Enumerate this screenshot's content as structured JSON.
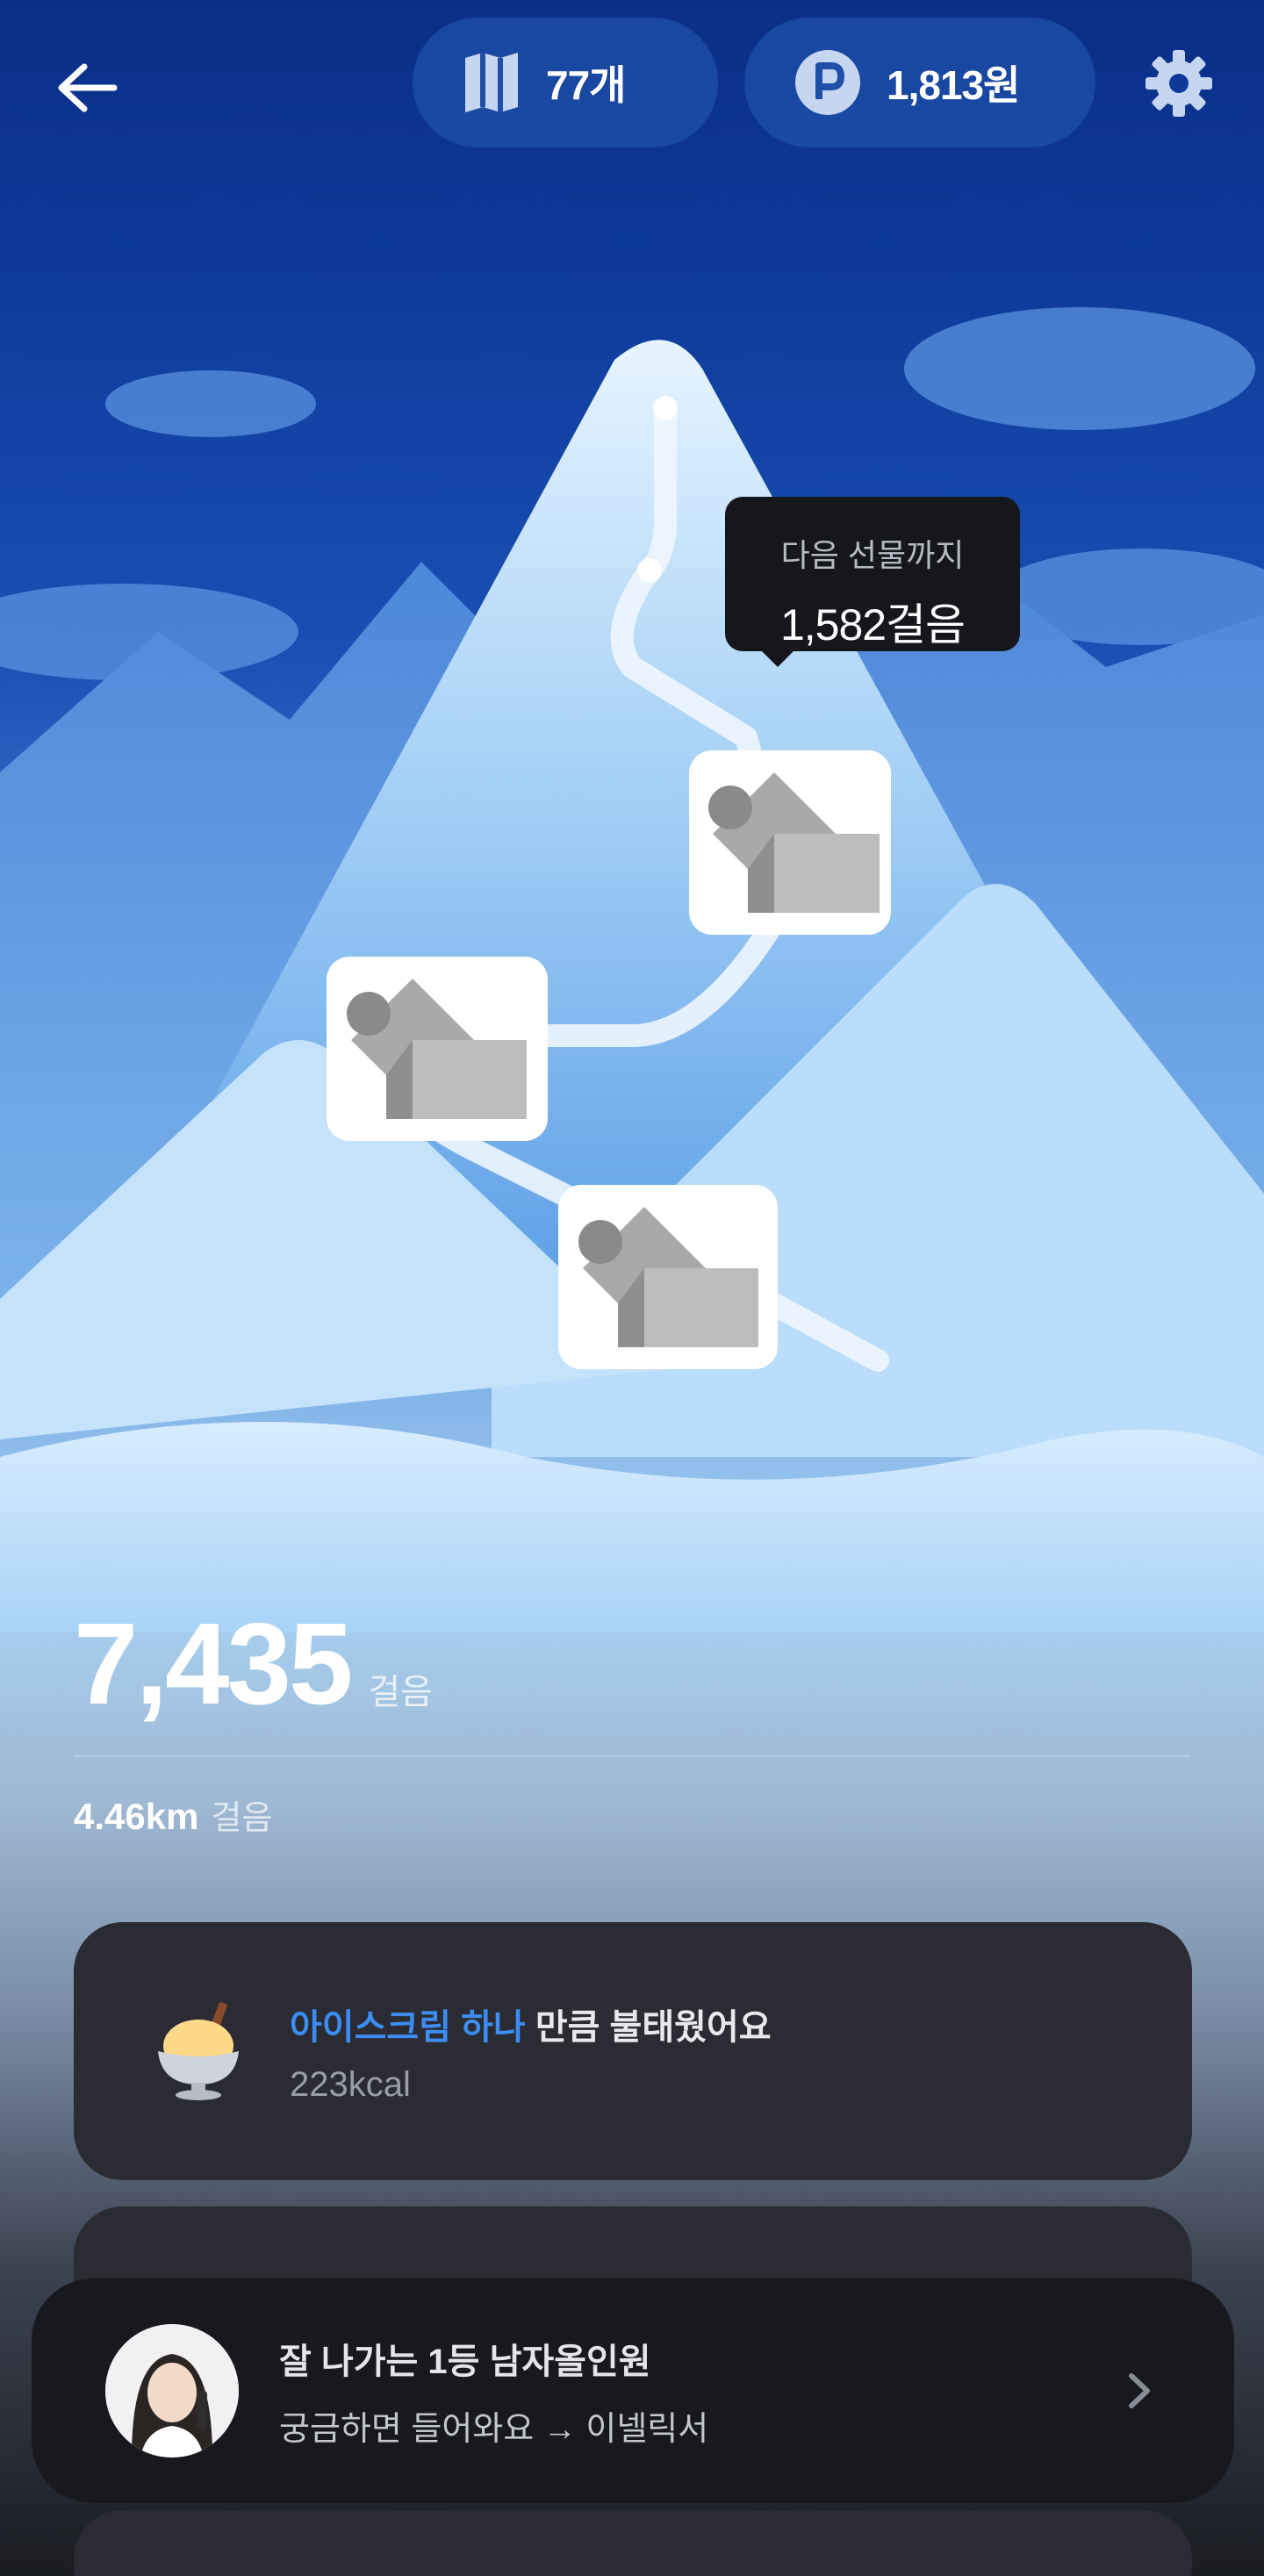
{
  "header": {
    "tickets_label": "77개",
    "points_label": "1,813원",
    "icons": {
      "back": "arrow-left-icon",
      "tickets": "ticket-icon",
      "points": "point-coin-icon",
      "settings": "gear-icon"
    }
  },
  "scene": {
    "tooltip": {
      "label": "다음 선물까지",
      "value": "1,582걸음"
    }
  },
  "stats": {
    "steps": "7,435",
    "steps_unit": "걸음",
    "distance": "4.46km",
    "distance_unit": "걸음"
  },
  "calorie_card": {
    "title_highlight": "아이스크림 하나",
    "title_rest": " 만큼 불태웠어요",
    "kcal": "223kcal"
  },
  "ad": {
    "title": "잘 나가는 1등 남자올인원",
    "subtitle": "궁금하면 들어와요 → 이넬릭서"
  },
  "colors": {
    "sky_top": "#0a2f86",
    "highlight_blue": "#3c8cf2",
    "card_bg": "#2a2b33",
    "tooltip_bg": "#15171c"
  }
}
